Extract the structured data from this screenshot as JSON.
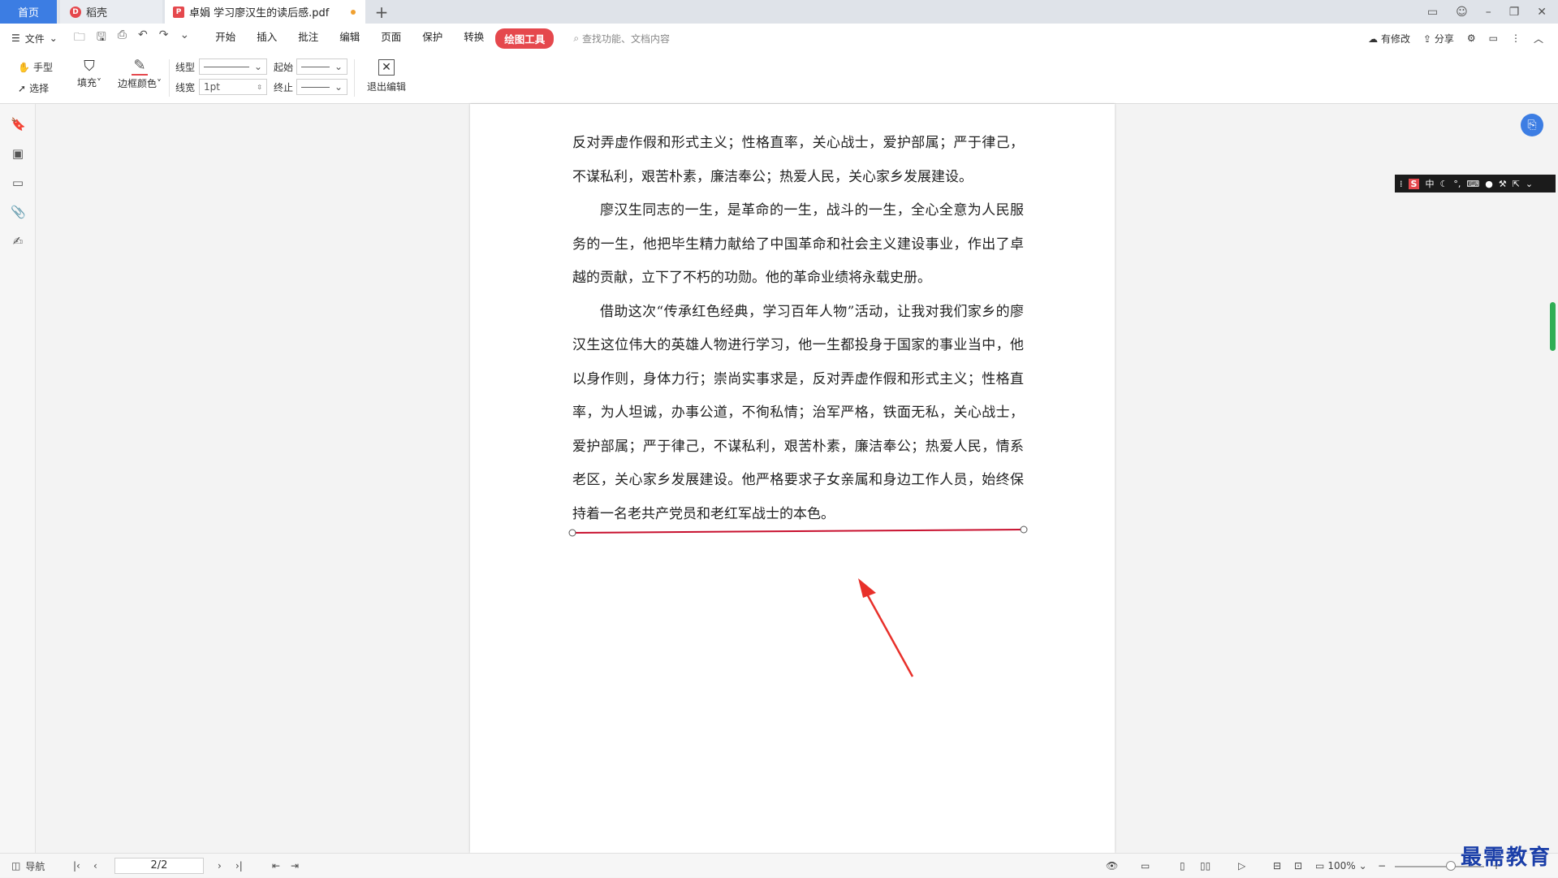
{
  "tabs": {
    "home": "首页",
    "daoke": "稻壳",
    "doc": "卓娟 学习廖汉生的读后感.pdf",
    "add": "+"
  },
  "menubar": {
    "file": "文件",
    "menus": [
      "开始",
      "插入",
      "批注",
      "编辑",
      "页面",
      "保护",
      "转换"
    ],
    "active": "绘图工具",
    "search_placeholder": "查找功能、文档内容",
    "modified": "有修改",
    "share": "分享"
  },
  "ribbon": {
    "hand": "手型",
    "select": "选择",
    "fill": "填充",
    "border_color": "边框颜色",
    "line_type": "线型",
    "line_width": "线宽",
    "line_width_value": "1pt",
    "start": "起始",
    "end": "终止",
    "exit_edit": "退出编辑"
  },
  "document": {
    "paragraphs": [
      "反对弄虚作假和形式主义；性格直率，关心战士，爱护部属；严于律己，不谋私利，艰苦朴素，廉洁奉公；热爱人民，关心家乡发展建设。",
      "廖汉生同志的一生，是革命的一生，战斗的一生，全心全意为人民服务的一生，他把毕生精力献给了中国革命和社会主义建设事业，作出了卓越的贡献，立下了不朽的功勋。他的革命业绩将永载史册。",
      "借助这次“传承红色经典，学习百年人物”活动，让我对我们家乡的廖汉生这位伟大的英雄人物进行学习，他一生都投身于国家的事业当中，他以身作则，身体力行；崇尚实事求是，反对弄虚作假和形式主义；性格直率，为人坦诚，办事公道，不徇私情；治军严格，铁面无私，关心战士，爱护部属；严于律己，不谋私利，艰苦朴素，廉洁奉公；热爱人民，情系老区，关心家乡发展建设。他严格要求子女亲属和身边工作人员，始终保持着一名老共产党员和老红军战士的本色。"
    ]
  },
  "ime": {
    "logo": "S",
    "mode": "中"
  },
  "status": {
    "nav": "导航",
    "page": "2/2",
    "zoom": "100%"
  },
  "watermark": "最需教育",
  "colors": {
    "accent": "#e5484d",
    "tab_home": "#3c7de3",
    "annotation_line": "#c8102e",
    "arrow": "#e8302a"
  }
}
